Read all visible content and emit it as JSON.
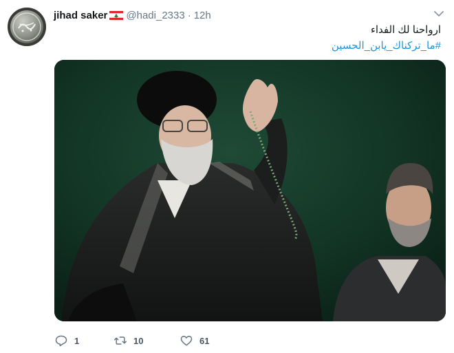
{
  "author": {
    "display_name": "jihad saker",
    "flag": "lebanon-flag-icon",
    "handle": "@hadi_2333",
    "separator": "·",
    "time": "12h"
  },
  "tweet": {
    "text_line1": "ارواحنا لك الفداء",
    "hashtag": "#ما_تركناك_يابن_الحسين"
  },
  "actions": {
    "reply_count": "1",
    "retweet_count": "10",
    "like_count": "61"
  },
  "colors": {
    "link": "#1b95e0",
    "muted": "#657786",
    "text": "#14171a"
  }
}
